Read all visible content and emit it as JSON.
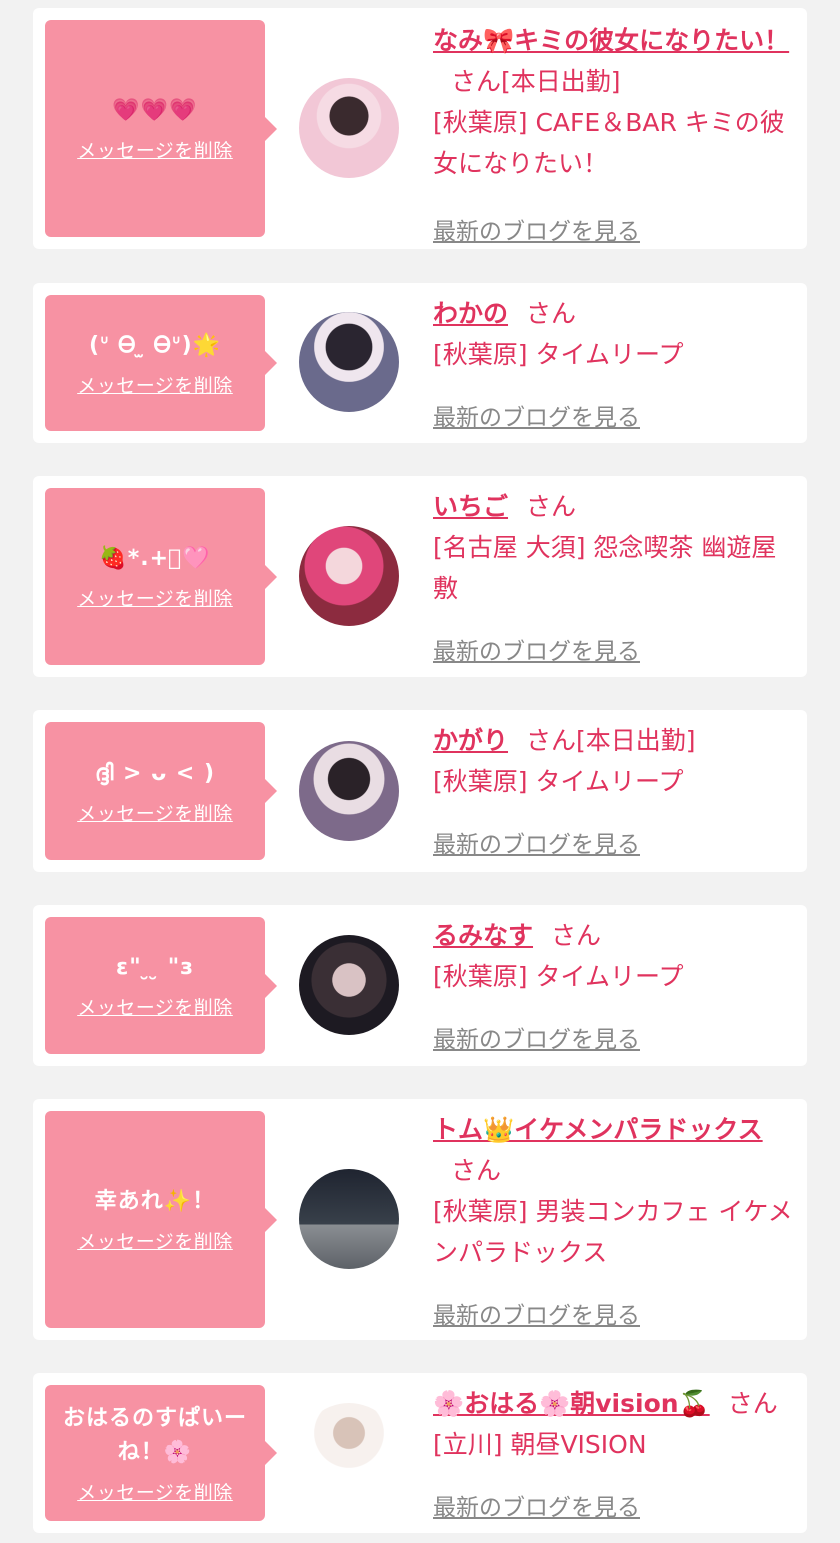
{
  "colors": {
    "accent": "#e0335e",
    "bubble": "#f792a3",
    "link_gray": "#888888",
    "background": "#f2f2f2"
  },
  "cards": [
    {
      "message": "💗💗💗",
      "delete_label": "メッセージを削除",
      "name": "なみ🎀キミの彼女になりたい！",
      "san": "さん[本日出勤]",
      "shop": "[秋葉原] CAFE＆BAR キミの彼女になりたい！",
      "blog_label": "最新のブログを見る",
      "avatar_icon": "avatar-photo"
    },
    {
      "message": "(ᐡ Ꮎ ̫ Ꮎᐡ)🌟",
      "delete_label": "メッセージを削除",
      "name": "わかの",
      "san": "さん",
      "shop": "[秋葉原] タイムリープ",
      "blog_label": "最新のブログを見る",
      "avatar_icon": "avatar-photo"
    },
    {
      "message": "🍓*.+ﾟ🩷",
      "delete_label": "メッセージを削除",
      "name": "いちご",
      "san": "さん",
      "shop": "[名古屋 大須] 怨念喫茶 幽遊屋敷",
      "blog_label": "最新のブログを見る",
      "avatar_icon": "avatar-photo"
    },
    {
      "message": "ദ്ദി > ᴗ < )",
      "delete_label": "メッセージを削除",
      "name": "かがり",
      "san": "さん[本日出勤]",
      "shop": "[秋葉原] タイムリープ",
      "blog_label": "最新のブログを見る",
      "avatar_icon": "avatar-photo"
    },
    {
      "message": "ε\" ̮ ̮ \"з",
      "delete_label": "メッセージを削除",
      "name": "るみなす",
      "san": "さん",
      "shop": "[秋葉原] タイムリープ",
      "blog_label": "最新のブログを見る",
      "avatar_icon": "avatar-photo"
    },
    {
      "message": "幸あれ✨！",
      "delete_label": "メッセージを削除",
      "name": "トム👑イケメンパラドックス",
      "san": "さん",
      "shop": "[秋葉原] 男装コンカフェ イケメンパラドックス",
      "blog_label": "最新のブログを見る",
      "avatar_icon": "avatar-photo"
    },
    {
      "message": "おはるのすぱいーね！🌸",
      "delete_label": "メッセージを削除",
      "name": "🌸おはる🌸朝vision🍒",
      "san": "さん",
      "shop": "[立川] 朝昼VISION",
      "blog_label": "最新のブログを見る",
      "avatar_icon": "avatar-photo"
    }
  ]
}
